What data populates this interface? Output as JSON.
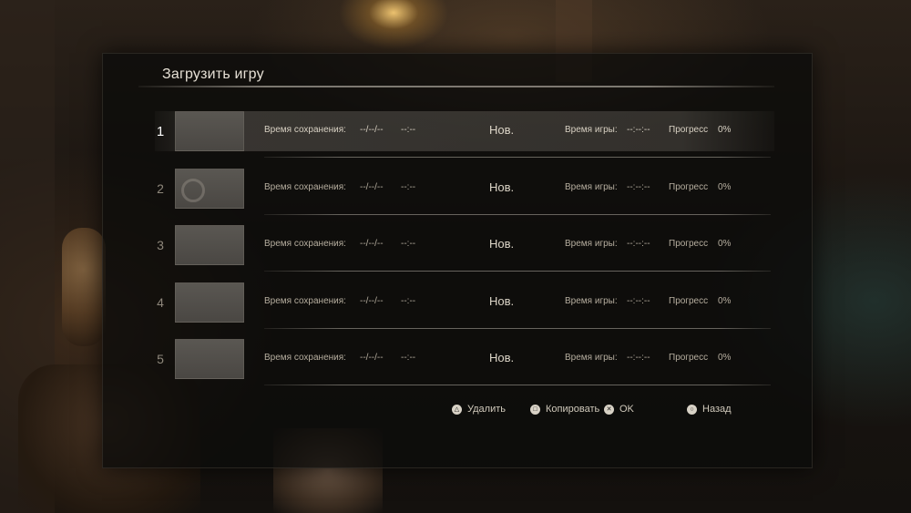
{
  "screen": {
    "title": "Загрузить игру"
  },
  "slots": [
    {
      "number": "1",
      "save_label": "Время сохранения:",
      "save_date": "--/--/--",
      "save_time": "--:--",
      "status": "Нов.",
      "play_label": "Время игры:",
      "play_time": "--:--:--",
      "progress_label": "Прогресс",
      "progress_value": "0%",
      "selected": true
    },
    {
      "number": "2",
      "save_label": "Время сохранения:",
      "save_date": "--/--/--",
      "save_time": "--:--",
      "status": "Нов.",
      "play_label": "Время игры:",
      "play_time": "--:--:--",
      "progress_label": "Прогресс",
      "progress_value": "0%",
      "selected": false
    },
    {
      "number": "3",
      "save_label": "Время сохранения:",
      "save_date": "--/--/--",
      "save_time": "--:--",
      "status": "Нов.",
      "play_label": "Время игры:",
      "play_time": "--:--:--",
      "progress_label": "Прогресс",
      "progress_value": "0%",
      "selected": false
    },
    {
      "number": "4",
      "save_label": "Время сохранения:",
      "save_date": "--/--/--",
      "save_time": "--:--",
      "status": "Нов.",
      "play_label": "Время игры:",
      "play_time": "--:--:--",
      "progress_label": "Прогресс",
      "progress_value": "0%",
      "selected": false
    },
    {
      "number": "5",
      "save_label": "Время сохранения:",
      "save_date": "--/--/--",
      "save_time": "--:--",
      "status": "Нов.",
      "play_label": "Время игры:",
      "play_time": "--:--:--",
      "progress_label": "Прогресс",
      "progress_value": "0%",
      "selected": false
    }
  ],
  "footer": {
    "delete": {
      "icon": "triangle-button-icon",
      "label": "Удалить"
    },
    "copy": {
      "icon": "square-button-icon",
      "label": "Копировать"
    },
    "ok": {
      "icon": "cross-button-icon",
      "label": "OK"
    },
    "back": {
      "icon": "circle-button-icon",
      "label": "Назад"
    }
  }
}
